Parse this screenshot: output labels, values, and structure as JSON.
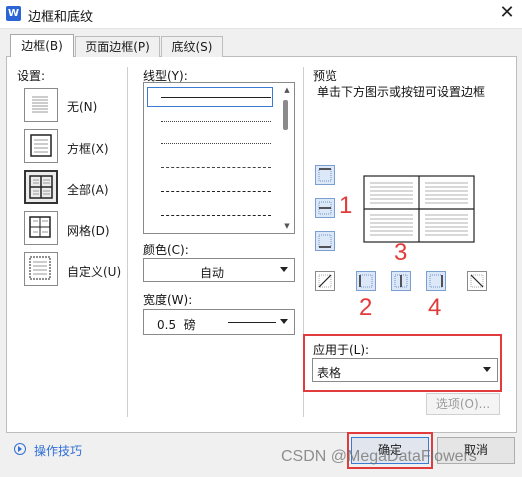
{
  "window": {
    "app_icon_letter": "W",
    "title": "边框和底纹",
    "close_glyph": "✕"
  },
  "tabs": [
    {
      "label": "边框(B)"
    },
    {
      "label": "页面边框(P)"
    },
    {
      "label": "底纹(S)"
    }
  ],
  "settings": {
    "heading": "设置:",
    "items": [
      {
        "label": "无(N)"
      },
      {
        "label": "方框(X)"
      },
      {
        "label": "全部(A)"
      },
      {
        "label": "网格(D)"
      },
      {
        "label": "自定义(U)"
      }
    ],
    "selected": "全部(A)"
  },
  "line_style": {
    "heading": "线型(Y):"
  },
  "color": {
    "heading": "颜色(C):",
    "value": "自动"
  },
  "width": {
    "heading": "宽度(W):",
    "value": "0.5  磅"
  },
  "preview": {
    "heading": "预览",
    "hint": "单击下方图示或按钮可设置边框"
  },
  "apply_to": {
    "heading": "应用于(L):",
    "value": "表格"
  },
  "options_button": "选项(O)...",
  "tips_link": "操作技巧",
  "ok_button": "确定",
  "cancel_button": "取消",
  "annotations": [
    "1",
    "2",
    "3",
    "4"
  ],
  "watermark": "CSDN @MegaDataFlowers",
  "colors": {
    "annotation_red": "#e23b3b",
    "accent_blue": "#3a7bd5"
  }
}
